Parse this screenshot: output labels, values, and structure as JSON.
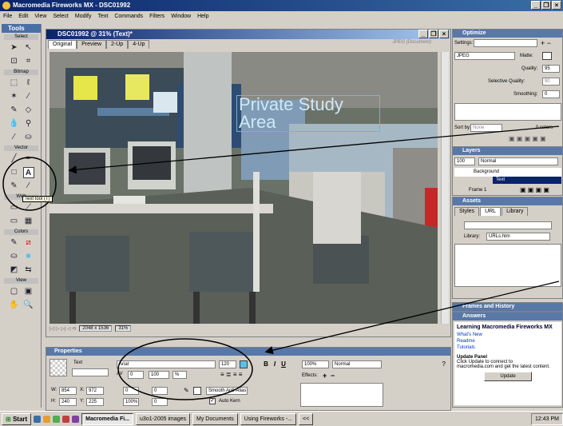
{
  "window": {
    "title": "Macromedia Fireworks MX - DSC01992"
  },
  "menu": [
    "File",
    "Edit",
    "View",
    "Select",
    "Modify",
    "Text",
    "Commands",
    "Filters",
    "Window",
    "Help"
  ],
  "tools": {
    "header": "Tools",
    "sections": [
      "Select",
      "Bitmap",
      "Vector",
      "Web",
      "Colors",
      "View"
    ],
    "tooltip": "Text tool (T)"
  },
  "document": {
    "title": "DSC01992 @ 31% (Text)*",
    "tabs": [
      "Original",
      "Preview",
      "2-Up",
      "4-Up"
    ],
    "format_label": "JPEG (Document)",
    "canvas_text": "Private Study Area",
    "size_readout": "2048 x 1536",
    "zoom": "31%"
  },
  "properties": {
    "header": "Properties",
    "tool_label": "Text",
    "font": "Arial",
    "size": "120",
    "kerning": "0",
    "leading": "100",
    "leading_unit": "%",
    "w": "854",
    "x": "972",
    "h": "240",
    "y": "225",
    "indent": "0",
    "space_before": "0",
    "space_after": "0",
    "scale": "100%",
    "blend": "Normal",
    "opacity": "100%",
    "effects_label": "Effects:",
    "antialias": "Smooth Anti-Alias",
    "auto_kern": "Auto Kern"
  },
  "optimize": {
    "header": "Optimize",
    "settings_label": "Settings:",
    "format": "JPEG",
    "matte_label": "Matte:",
    "quality_label": "Quality:",
    "quality": "95",
    "selective_quality_label": "Selective Quality:",
    "selective_quality": "90",
    "smoothing_label": "Smoothing:",
    "smoothing": "0",
    "sort_label": "Sort by:",
    "sort_value": "None",
    "colors": "0 colors"
  },
  "layers": {
    "header": "Layers",
    "opacity": "100",
    "blend": "Normal",
    "layer_name": "Background",
    "sublayer": "Text",
    "frame": "Frame 1"
  },
  "assets": {
    "header": "Assets",
    "tabs": [
      "Styles",
      "URL",
      "Library"
    ],
    "library_label": "Library:",
    "library_value": "URLs.htm"
  },
  "frames_history": {
    "header": "Frames and History"
  },
  "answers": {
    "header": "Answers",
    "title": "Learning Macromedia Fireworks MX",
    "links": [
      "What's New",
      "Readme",
      "Tutorials"
    ],
    "update_title": "Update Panel",
    "update_text_1": "Click Update to connect to",
    "update_text_2": "macromedia.com and get the latest content.",
    "update_button": "Update"
  },
  "taskbar": {
    "start": "Start",
    "tasks": [
      "Macromedia Fi...",
      "u3o1-2005 images",
      "My Documents",
      "Using Fireworks -...",
      "<<"
    ],
    "clock": "12:43 PM"
  },
  "colors": {
    "title_blue": "#0a246a",
    "panel_header": "#5878a8",
    "canvas_text": "#cfe8f8"
  }
}
